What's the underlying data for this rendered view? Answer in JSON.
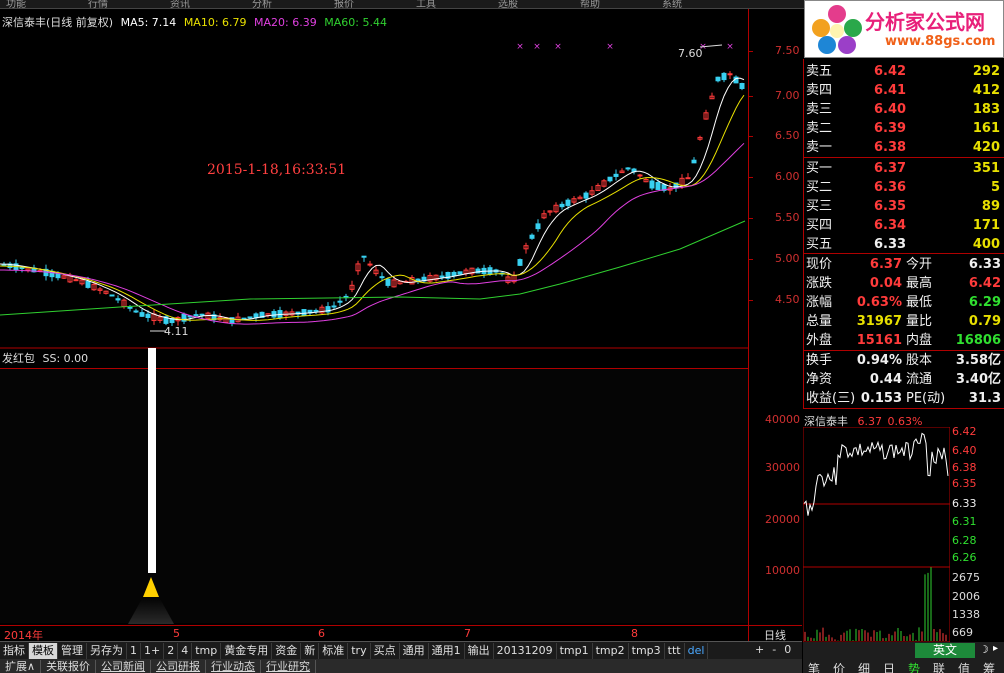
{
  "top_menu": [
    "功能",
    "行情",
    "资讯",
    "分析",
    "报价",
    "工具",
    "选股",
    "帮助",
    "系统"
  ],
  "chart_header": {
    "name": "深信泰丰(日线 前复权)",
    "ma5": "MA5: 7.14",
    "ma10": "MA10: 6.79",
    "ma20": "MA20: 6.39",
    "ma60": "MA60: 5.44"
  },
  "annotations": {
    "timestamp": "2015-1-18,16:33:51",
    "high_label": "7.60",
    "low_label": "4.11"
  },
  "price_axis": [
    "7.50",
    "7.00",
    "6.50",
    "6.00",
    "5.50",
    "5.00",
    "4.50"
  ],
  "volume_axis": [
    "40000",
    "30000",
    "20000",
    "10000"
  ],
  "x_axis": {
    "year": "2014年",
    "months": [
      "5",
      "6",
      "7",
      "8"
    ],
    "period": "日线",
    "controls": [
      "+",
      "-",
      "0"
    ]
  },
  "indicator": {
    "name": "发红包",
    "ss": "SS: 0.00"
  },
  "tabs_primary": [
    "指标",
    "模板",
    "管理",
    "另存为",
    "1",
    "1+",
    "2",
    "4",
    "tmp",
    "黄金专用",
    "资金",
    "新",
    "标准",
    "try",
    "买点",
    "通用",
    "通用1",
    "输出",
    "20131209",
    "tmp1",
    "tmp2",
    "tmp3",
    "ttt",
    "del"
  ],
  "tabs_primary_active": "模板",
  "tabs_secondary": [
    "扩展∧",
    "关联报价",
    "公司新闻",
    "公司研报",
    "行业动态",
    "行业研究"
  ],
  "logo": {
    "text": "分析家公式网",
    "url": "www.88gs.com"
  },
  "order_book": {
    "asks": [
      {
        "label": "卖五",
        "price": "6.42",
        "vol": "292"
      },
      {
        "label": "卖四",
        "price": "6.41",
        "vol": "412"
      },
      {
        "label": "卖三",
        "price": "6.40",
        "vol": "183"
      },
      {
        "label": "卖二",
        "price": "6.39",
        "vol": "161"
      },
      {
        "label": "卖一",
        "price": "6.38",
        "vol": "420"
      }
    ],
    "bids": [
      {
        "label": "买一",
        "price": "6.37",
        "vol": "351"
      },
      {
        "label": "买二",
        "price": "6.36",
        "vol": "5"
      },
      {
        "label": "买三",
        "price": "6.35",
        "vol": "89"
      },
      {
        "label": "买四",
        "price": "6.34",
        "vol": "171"
      },
      {
        "label": "买五",
        "price": "6.33",
        "vol": "400"
      }
    ]
  },
  "stats": [
    {
      "l1": "现价",
      "v1": "6.37",
      "l2": "今开",
      "v2": "6.33"
    },
    {
      "l1": "涨跌",
      "v1": "0.04",
      "l2": "最高",
      "v2": "6.42"
    },
    {
      "l1": "涨幅",
      "v1": "0.63%",
      "l2": "最低",
      "v2": "6.29"
    },
    {
      "l1": "总量",
      "v1": "31967",
      "l2": "量比",
      "v2": "0.79"
    },
    {
      "l1": "外盘",
      "v1": "15161",
      "l2": "内盘",
      "v2": "16806"
    }
  ],
  "fundamentals": [
    {
      "l1": "换手",
      "v1": "0.94%",
      "l2": "股本",
      "v2": "3.58亿"
    },
    {
      "l1": "净资",
      "v1": "0.44",
      "l2": "流通",
      "v2": "3.40亿"
    },
    {
      "l1": "收益(三)",
      "v1": "0.153",
      "l2": "PE(动)",
      "v2": "31.3"
    }
  ],
  "mini_chart": {
    "name": "深信泰丰",
    "price": "6.37",
    "pct": "0.63%",
    "axis": [
      "6.42",
      "6.40",
      "6.38",
      "6.35",
      "6.33",
      "6.31",
      "6.28",
      "6.26"
    ],
    "vol_axis": [
      "2675",
      "2006",
      "1338",
      "669"
    ]
  },
  "bottom_right": {
    "lang": "英文",
    "tabs": [
      "笔",
      "价",
      "细",
      "日",
      "势",
      "联",
      "值",
      "筹"
    ]
  },
  "colors": {
    "up": "#ff3b3b",
    "down": "#38d0f0",
    "ma5": "#ffffff",
    "ma10": "#e8e000",
    "ma20": "#e040e0",
    "ma60": "#30d030",
    "border": "#b00000"
  }
}
